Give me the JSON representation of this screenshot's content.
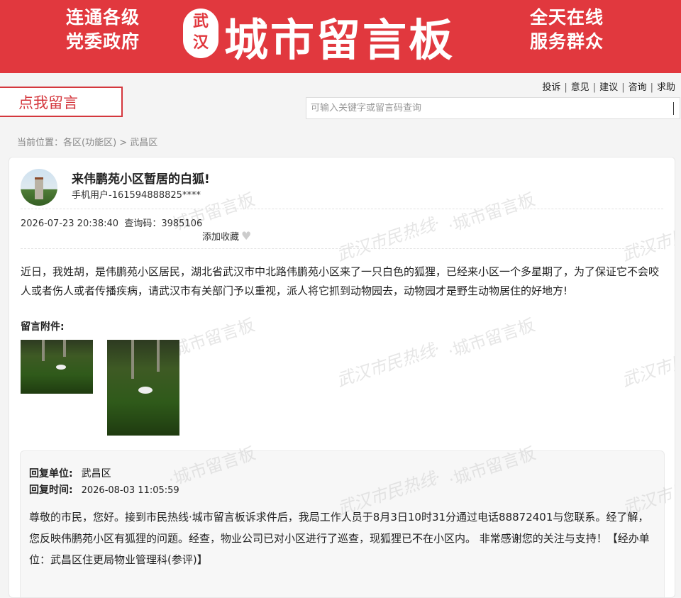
{
  "banner": {
    "left_line1": "连通各级",
    "left_line2": "党委政府",
    "seal_line1": "武",
    "seal_line2": "汉",
    "brand": "城市留言板",
    "right_line1": "全天在线",
    "right_line2": "服务群众",
    "color": "#e1383e"
  },
  "quicklinks": [
    "投诉",
    "意见",
    "建议",
    "咨询",
    "求助"
  ],
  "message_button": "点我留言",
  "search": {
    "placeholder": "可输入关键字或留言码查询"
  },
  "breadcrumb": "当前位置：各区(功能区) > 武昌区",
  "post": {
    "title": "来伟鹏苑小区暂居的白狐!",
    "user": "手机用户-161594888825****",
    "datetime": "2026-07-23 20:38:40",
    "query_code": "查询码：3985106",
    "favorite": "添加收藏",
    "content": "近日，我姓胡，是伟鹏苑小区居民，湖北省武汉市中北路伟鹏苑小区来了一只白色的狐狸，已经来小区一个多星期了，为了保证它不会咬人或者伤人或者传播疾病，请武汉市有关部门予以重视，派人将它抓到动物园去，动物园才是野生动物居住的好地方!",
    "attachments_label": "留言附件:"
  },
  "reply": {
    "unit_label": "回复单位:",
    "unit": "武昌区",
    "time_label": "回复时间:",
    "time": "2026-08-03 11:05:59",
    "content": "尊敬的市民，您好。接到市民热线·城市留言板诉求件后，我局工作人员于8月3日10时31分通过电话88872401与您联系。经了解，您反映伟鹏苑小区有狐狸的问题。经查，物业公司已对小区进行了巡查，现狐狸已不在小区内。 非常感谢您的关注与支持！【经办单位：武昌区住更局物业管理科(参评)】"
  },
  "watermarks": {
    "brand": "·城市留言板",
    "script": "武汉市民热线·"
  }
}
